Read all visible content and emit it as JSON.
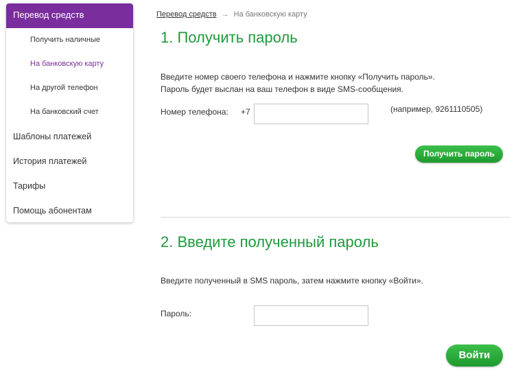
{
  "sidebar": {
    "header": "Перевод средств",
    "sub_items": [
      {
        "label": "Получить наличные"
      },
      {
        "label": "На банковскую карту"
      },
      {
        "label": "На другой телефон"
      },
      {
        "label": "На банковский счет"
      }
    ],
    "items": [
      {
        "label": "Шаблоны платежей"
      },
      {
        "label": "История платежей"
      },
      {
        "label": "Тарифы"
      },
      {
        "label": "Помощь абонентам"
      }
    ]
  },
  "breadcrumb": {
    "link": "Перевод средств",
    "arrow": "→",
    "current": "На банковскую карту"
  },
  "step1": {
    "title": "1. Получить пароль",
    "instruction_line1": "Введите номер своего телефона и нажмите кнопку «Получить пароль».",
    "instruction_line2": "Пароль будет выслан на ваш телефон в виде SMS-сообщения.",
    "phone_label": "Номер телефона:",
    "phone_prefix": "+7",
    "phone_value": "",
    "phone_hint": "(например, 9261110505)",
    "button": "Получить пароль"
  },
  "step2": {
    "title": "2. Введите полученный пароль",
    "instruction": "Введите полученный в SMS пароль, затем нажмите кнопку «Войти».",
    "password_label": "Пароль:",
    "password_value": "",
    "button": "Войти"
  },
  "colors": {
    "accent_purple": "#7a2d9c",
    "heading_green": "#1d9a3c",
    "button_green": "#2aae3a"
  }
}
